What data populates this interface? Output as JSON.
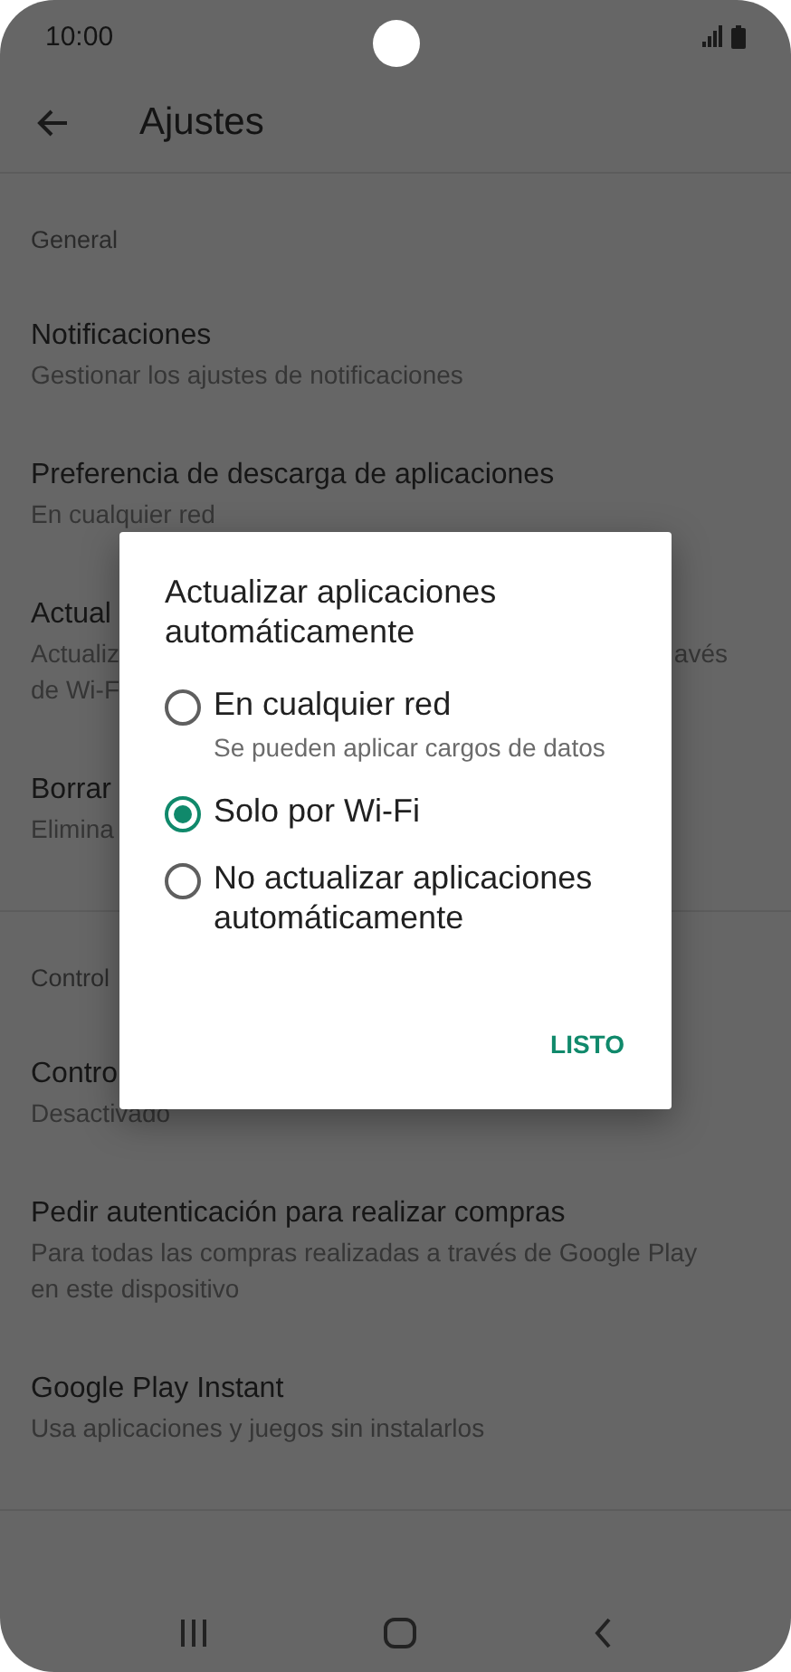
{
  "status_bar": {
    "time": "10:00"
  },
  "toolbar": {
    "title": "Ajustes"
  },
  "sections": [
    {
      "header": "General",
      "items": [
        {
          "title": "Notificaciones",
          "lines": [
            {
              "text": "Gestionar los ajustes de notificaciones"
            }
          ]
        },
        {
          "title": "Preferencia de descarga de aplicaciones",
          "lines": [
            {
              "text": "En cualquier red"
            }
          ]
        },
        {
          "title": "Actual",
          "lines": [
            {
              "text": "Actualiz",
              "right": "avés"
            },
            {
              "text": "de Wi-F"
            }
          ]
        },
        {
          "title": "Borrar",
          "lines": [
            {
              "text": "Elimina"
            }
          ]
        }
      ]
    },
    {
      "header": "Control",
      "items": [
        {
          "title": "Contro",
          "lines": [
            {
              "text": "Desactivado"
            }
          ]
        },
        {
          "title": "Pedir autenticación para realizar compras",
          "lines": [
            {
              "text": "Para todas las compras realizadas a través de Google Play"
            },
            {
              "text": "en este dispositivo"
            }
          ]
        },
        {
          "title": "Google Play Instant",
          "lines": [
            {
              "text": "Usa aplicaciones y juegos sin instalarlos"
            }
          ]
        }
      ]
    }
  ],
  "dialog": {
    "title": "Actualizar aplicaciones automáticamente",
    "options": [
      {
        "label": "En cualquier red",
        "description": "Se pueden aplicar cargos de datos",
        "selected": false
      },
      {
        "label": "Solo por Wi-Fi",
        "selected": true
      },
      {
        "label": "No actualizar aplicaciones automáticamente",
        "selected": false
      }
    ],
    "button": "LISTO"
  }
}
